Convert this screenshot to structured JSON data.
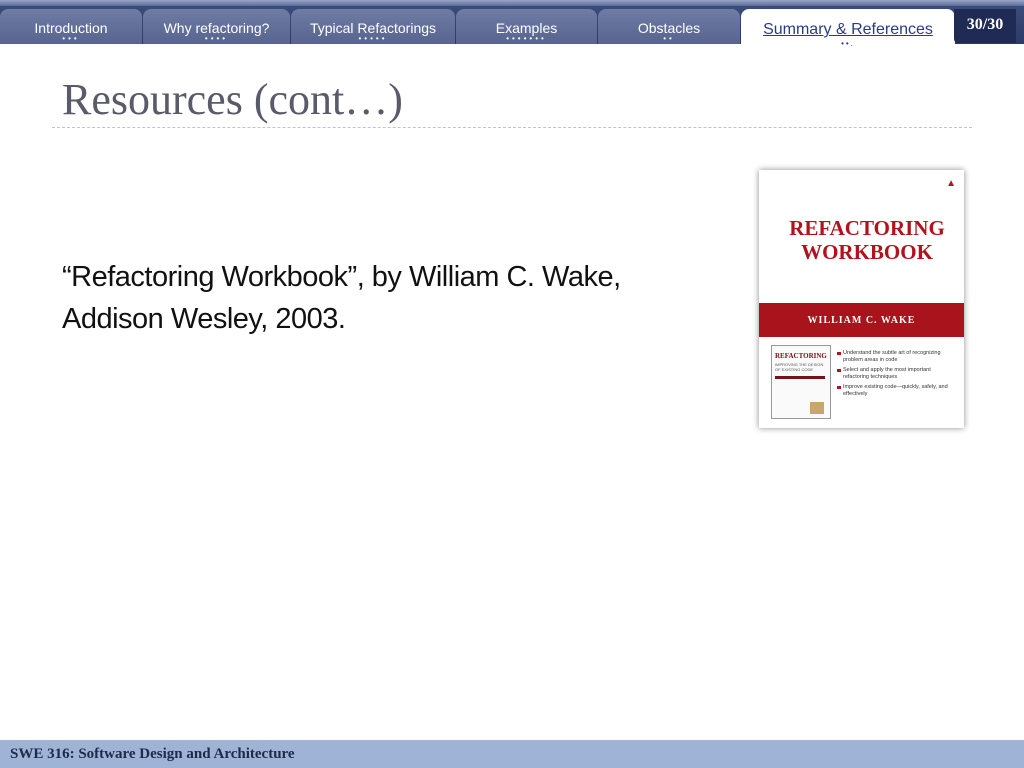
{
  "nav": {
    "tabs": [
      {
        "label": "Introduction",
        "dots": "•••"
      },
      {
        "label": "Why refactoring?",
        "dots": "••••"
      },
      {
        "label": "Typical Refactorings",
        "dots": "•••••"
      },
      {
        "label": "Examples",
        "dots": "•••••••"
      },
      {
        "label": "Obstacles",
        "dots": "••"
      },
      {
        "label": "Summary & References",
        "dots": "••."
      }
    ],
    "page_number": "30/30"
  },
  "slide": {
    "title": "Resources (cont…)",
    "body_line1": "“Refactoring Workbook”, by William C. Wake,",
    "body_line2": "Addison Wesley, 2003."
  },
  "book": {
    "title_line1": "REFACTORING",
    "title_line2": "WORKBOOK",
    "author": "WILLIAM C. WAKE",
    "mini_title": "REFACTORING",
    "mini_subtitle": "IMPROVING THE DESIGN OF EXISTING CODE",
    "bullets": [
      "Understand the subtle art of recognizing problem areas in code",
      "Select and apply the most important refactoring techniques",
      "Improve existing code—quickly, safely, and effectively"
    ],
    "logo_icon": "publisher-triangle-icon"
  },
  "footer": {
    "text": "SWE 316: Software Design and Architecture"
  },
  "colors": {
    "nav_bg": "#2c3b66",
    "tab_bg": "#6f7ca4",
    "active_tab_text": "#2a3a8a",
    "title": "#5a5a6a",
    "footer_bg": "#9eb3d5",
    "book_red": "#b3121d"
  }
}
